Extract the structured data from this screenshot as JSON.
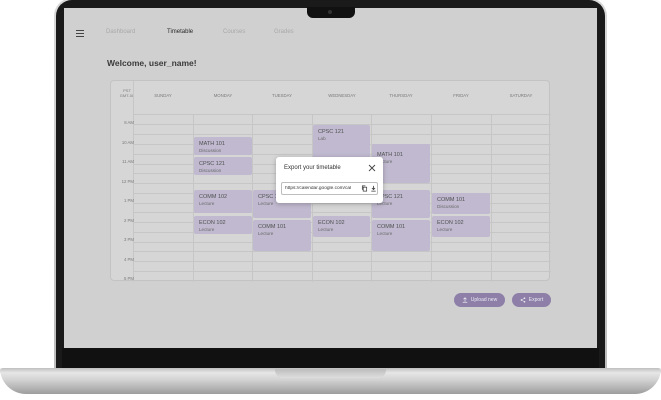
{
  "nav": {
    "tabs": [
      {
        "label": "Dashboard"
      },
      {
        "label": "Timetable"
      },
      {
        "label": "Courses"
      },
      {
        "label": "Grades"
      }
    ]
  },
  "welcome": "Welcome, user_name!",
  "calendar": {
    "timezone_line1": "PST",
    "timezone_line2": "GMT-08",
    "days": [
      "SUNDAY",
      "MONDAY",
      "TUESDAY",
      "WEDNESDAY",
      "THURSDAY",
      "FRIDAY",
      "SATURDAY"
    ],
    "times": [
      "8 AM",
      "10 AM",
      "11 AM",
      "12 PM",
      "1 PM",
      "2 PM",
      "3 PM",
      "4 PM",
      "5 PM"
    ],
    "events": [
      {
        "course": "MATH 101",
        "type": "Discussion"
      },
      {
        "course": "CPSC 121",
        "type": "Discussion"
      },
      {
        "course": "COMM 102",
        "type": "Lecture"
      },
      {
        "course": "ECON 102",
        "type": "Lecture"
      },
      {
        "course": "CPSC 121",
        "type": "Lecture"
      },
      {
        "course": "COMM 101",
        "type": "Lecture"
      },
      {
        "course": "CPSC 121",
        "type": "Lab"
      },
      {
        "course": "ECON 102",
        "type": "Lecture"
      },
      {
        "course": "MATH 101",
        "type": "Lecture"
      },
      {
        "course": "CPSC 121",
        "type": "Lecture"
      },
      {
        "course": "COMM 101",
        "type": "Lecture"
      },
      {
        "course": "COMM 101",
        "type": "Discussion"
      },
      {
        "course": "ECON 102",
        "type": "Lecture"
      }
    ]
  },
  "buttons": {
    "upload": "Upload new",
    "export": "Export"
  },
  "modal": {
    "title": "Export your timetable",
    "url": "https://calendar.google.com/cal"
  },
  "colors": {
    "accent": "#8d7fa8",
    "event_block": "#c0b9cf"
  }
}
